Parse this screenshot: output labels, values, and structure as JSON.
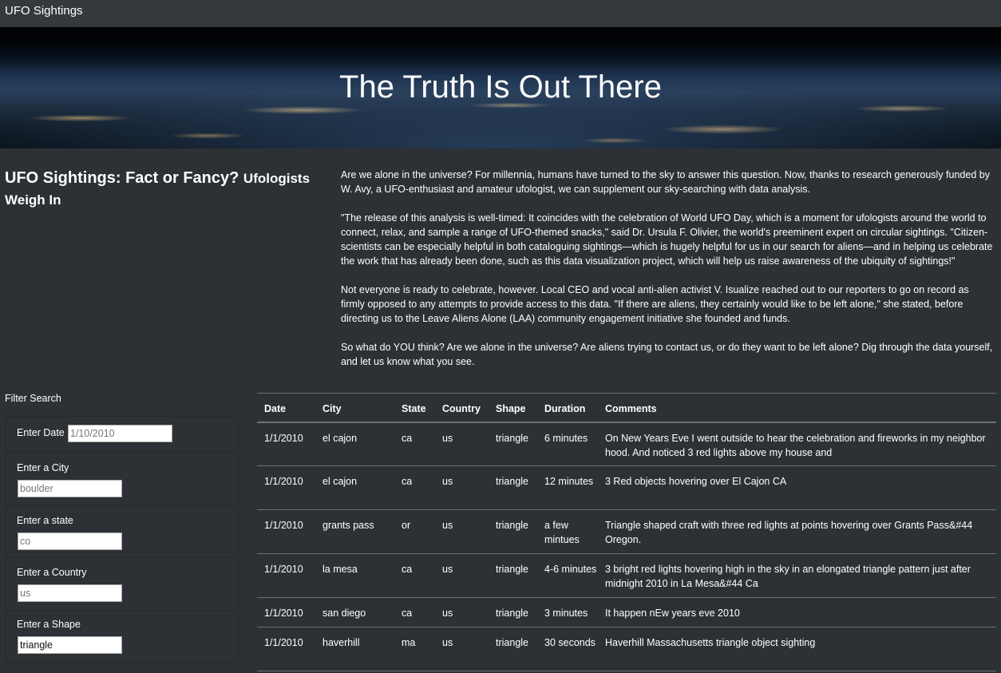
{
  "nav": {
    "brand": "UFO Sightings"
  },
  "hero": {
    "title": "The Truth Is Out There"
  },
  "article": {
    "heading": "UFO Sightings: Fact or Fancy?",
    "heading_small": "Ufologists Weigh In",
    "paragraphs": [
      "Are we alone in the universe? For millennia, humans have turned to the sky to answer this question. Now, thanks to research generously funded by W. Avy, a UFO-enthusiast and amateur ufologist, we can supplement our sky-searching with data analysis.",
      "\"The release of this analysis is well-timed: It coincides with the celebration of World UFO Day, which is a moment for ufologists around the world to connect, relax, and sample a range of UFO-themed snacks,\" said Dr. Ursula F. Olivier, the world's preeminent expert on circular sightings. \"Citizen-scientists can be especially helpful in both cataloguing sightings—which is hugely helpful for us in our search for aliens—and in helping us celebrate the work that has already been done, such as this data visualization project, which will help us raise awareness of the ubiquity of sightings!\"",
      "Not everyone is ready to celebrate, however. Local CEO and vocal anti-alien activist V. Isualize reached out to our reporters to go on record as firmly opposed to any attempts to provide access to this data. \"If there are aliens, they certainly would like to be left alone,\" she stated, before directing us to the Leave Aliens Alone (LAA) community engagement initiative she founded and funds.",
      "So what do YOU think? Are we alone in the universe? Are aliens trying to contact us, or do they want to be left alone? Dig through the data yourself, and let us know what you see."
    ]
  },
  "filters": {
    "title": "Filter Search",
    "date": {
      "label": "Enter Date",
      "placeholder": "1/10/2010",
      "value": ""
    },
    "city": {
      "label": "Enter a City",
      "placeholder": "boulder",
      "value": ""
    },
    "state": {
      "label": "Enter a state",
      "placeholder": "co",
      "value": ""
    },
    "country": {
      "label": "Enter a Country",
      "placeholder": "us",
      "value": ""
    },
    "shape": {
      "label": "Enter a Shape",
      "placeholder": "",
      "value": "triangle"
    }
  },
  "table": {
    "headers": [
      "Date",
      "City",
      "State",
      "Country",
      "Shape",
      "Duration",
      "Comments"
    ],
    "rows": [
      [
        "1/1/2010",
        "el cajon",
        "ca",
        "us",
        "triangle",
        "6 minutes",
        "On New Years Eve I went outside to hear the celebration and fireworks in my neighbor hood. And noticed 3 red lights above my house and"
      ],
      [
        "1/1/2010",
        "el cajon",
        "ca",
        "us",
        "triangle",
        "12 minutes",
        "3 Red objects hovering over El Cajon CA"
      ],
      [
        "1/1/2010",
        "grants pass",
        "or",
        "us",
        "triangle",
        "a few mintues",
        "Triangle shaped craft with three red lights at points hovering over Grants Pass&#44 Oregon."
      ],
      [
        "1/1/2010",
        "la mesa",
        "ca",
        "us",
        "triangle",
        "4-6 minutes",
        "3 bright red lights hovering high in the sky in an elongated triangle pattern just after midnight 2010 in La Mesa&#44 Ca"
      ],
      [
        "1/1/2010",
        "san diego",
        "ca",
        "us",
        "triangle",
        "3 minutes",
        "It happen nEw years eve 2010"
      ],
      [
        "1/1/2010",
        "haverhill",
        "ma",
        "us",
        "triangle",
        "30 seconds",
        "Haverhill Massachusetts triangle object sighting"
      ]
    ]
  }
}
